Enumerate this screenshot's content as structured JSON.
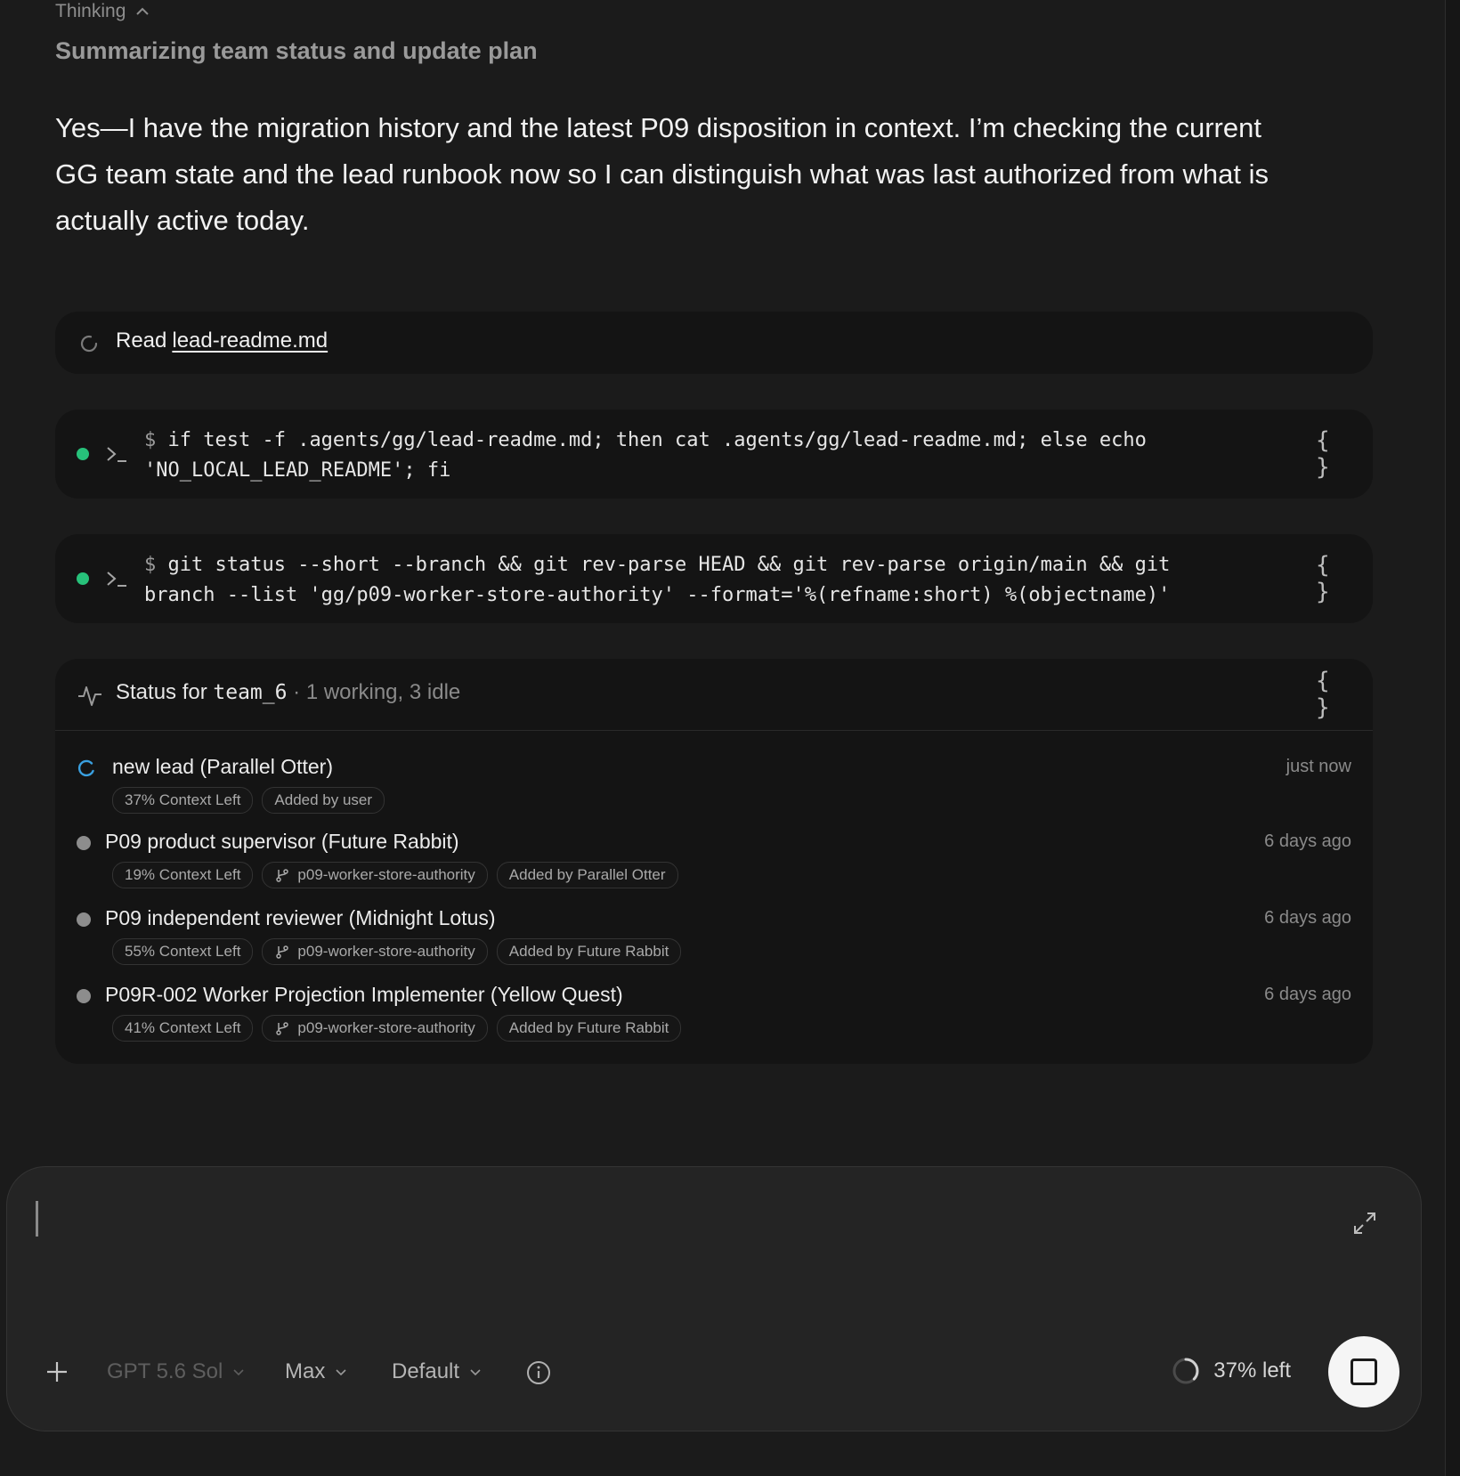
{
  "thinking": {
    "label": "Thinking"
  },
  "subheading": "Summarizing team status and update plan",
  "message": "Yes—I have the migration history and the latest P09 disposition in context. I’m checking the current GG team state and the lead runbook now so I can distinguish what was last authorized from what is actually active today.",
  "read_step": {
    "verb": "Read",
    "file": "lead-readme.md"
  },
  "commands": [
    {
      "prefix": "$",
      "text": "if test -f .agents/gg/lead-readme.md; then cat .agents/gg/lead-readme.md; else echo\n'NO_LOCAL_LEAD_README'; fi",
      "status": "success"
    },
    {
      "prefix": "$",
      "text": "git status --short --branch && git rev-parse HEAD && git rev-parse origin/main && git\nbranch --list 'gg/p09-worker-store-authority' --format='%(refname:short) %(objectname)'",
      "status": "success"
    }
  ],
  "braces_label": "{ }",
  "status": {
    "prefix": "Status for",
    "team": "team_6",
    "summary": "· 1 working, 3 idle",
    "members": [
      {
        "name": "new lead (Parallel Otter)",
        "time": "just now",
        "state": "working",
        "context": "37% Context Left",
        "branch": null,
        "added_by": "Added by user"
      },
      {
        "name": "P09 product supervisor (Future Rabbit)",
        "time": "6 days ago",
        "state": "idle",
        "context": "19% Context Left",
        "branch": "p09-worker-store-authority",
        "added_by": "Added by Parallel Otter"
      },
      {
        "name": "P09 independent reviewer (Midnight Lotus)",
        "time": "6 days ago",
        "state": "idle",
        "context": "55% Context Left",
        "branch": "p09-worker-store-authority",
        "added_by": "Added by Future Rabbit"
      },
      {
        "name": "P09R-002 Worker Projection Implementer (Yellow Quest)",
        "time": "6 days ago",
        "state": "idle",
        "context": "41% Context Left",
        "branch": "p09-worker-store-authority",
        "added_by": "Added by Future Rabbit"
      }
    ]
  },
  "composer": {
    "model": "GPT 5.6 Sol",
    "effort": "Max",
    "mode": "Default",
    "context_left": "37% left",
    "context_fraction": 0.37
  },
  "colors": {
    "success_dot": "#27c17a",
    "working_spinner": "#3aa0e0",
    "idle_dot": "#8d8d8d"
  }
}
